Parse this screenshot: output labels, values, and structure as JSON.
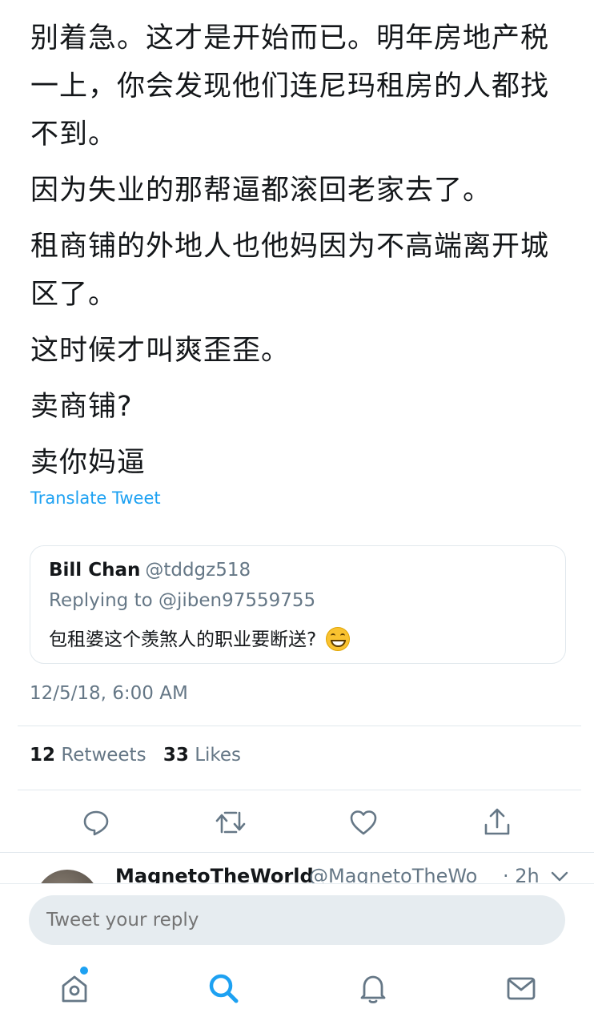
{
  "tweet": {
    "paragraphs": [
      "别着急。这才是开始而已。明年房地产税一上，你会发现他们连尼玛租房的人都找不到。",
      "因为失业的那帮逼都滚回老家去了。",
      "租商铺的外地人也他妈因为不高端离开城区了。",
      "这时候才叫爽歪歪。",
      "卖商铺?",
      "卖你妈逼"
    ],
    "translate_label": "Translate Tweet",
    "timestamp": "12/5/18, 6:00 AM",
    "retweets_count": "12",
    "retweets_label": "Retweets",
    "likes_count": "33",
    "likes_label": "Likes"
  },
  "quoted": {
    "name": "Bill Chan",
    "handle": "@tddgz518",
    "replying_to": "Replying to @jiben97559755",
    "text": "包租婆这个羡煞人的职业要断送?",
    "emoji": "grinning-face-emoji"
  },
  "actions": {
    "reply_icon": "reply-icon",
    "retweet_icon": "retweet-icon",
    "like_icon": "heart-icon",
    "share_icon": "share-icon"
  },
  "reply_preview": {
    "name": "MagnetoTheWorld",
    "handle": "@MagnetoTheWo",
    "time": "· 2h"
  },
  "composer": {
    "placeholder": "Tweet your reply"
  },
  "tabs": [
    "home",
    "search",
    "notifications",
    "messages"
  ],
  "colors": {
    "accent": "#1da1f2",
    "text": "#14171a",
    "muted": "#657786",
    "border": "#e1e8ed"
  }
}
